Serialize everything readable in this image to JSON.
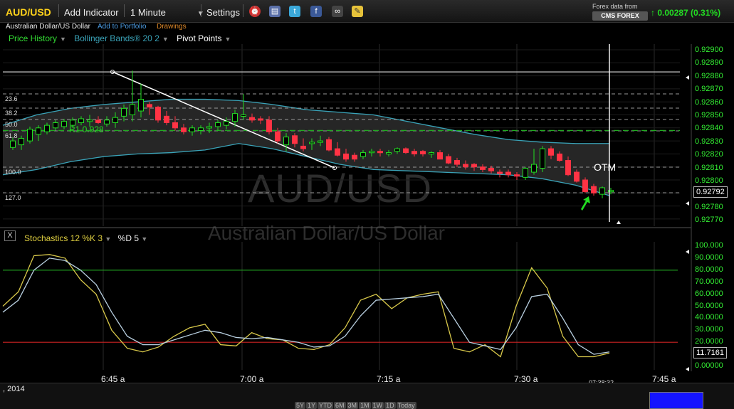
{
  "toolbar": {
    "symbol": "AUD/USD",
    "add_indicator": "Add Indicator",
    "interval": "1 Minute",
    "settings": "Settings",
    "provider_line1": "Forex data from",
    "provider_logo": "CMS FOREX",
    "change": "0.00287 (0.31%)",
    "change_arrow": "↑"
  },
  "subtitle": {
    "pair_name": "Australian Dollar/US Dollar",
    "add_portfolio": "Add to Portfolio",
    "drawings": "Drawings"
  },
  "legend": {
    "price_history": "Price History",
    "bollinger": "Bollinger Bands® 20 2",
    "pivot": "Pivot Points"
  },
  "stochastics": {
    "close": "X",
    "label": "Stochastics 12 %K 3",
    "d_label": "%D 5",
    "current": "11.7161",
    "y_ticks": [
      "100.000",
      "90.0000",
      "80.0000",
      "70.0000",
      "60.0000",
      "50.0000",
      "40.0000",
      "30.0000",
      "20.0000",
      "10.0000",
      "0.00000"
    ]
  },
  "watermark": {
    "symbol": "AUD/USD",
    "name": "Australian Dollar/US Dollar"
  },
  "price_axis": {
    "ticks": [
      "0.92900",
      "0.92890",
      "0.92880",
      "0.92870",
      "0.92860",
      "0.92850",
      "0.92840",
      "0.92830",
      "0.92820",
      "0.92810",
      "0.92800",
      "0.92790",
      "0.92780",
      "0.92770"
    ],
    "current": "0.92792"
  },
  "fib_levels": [
    "23.6",
    "38.2",
    "50.0",
    "61.8",
    "100.0",
    "127.0"
  ],
  "annotations": {
    "r1": "R1 0.928",
    "otm": "OTM"
  },
  "time_axis": {
    "ticks": [
      "6:45 a",
      "7:00 a",
      "7:15 a",
      "7:30 a",
      "7:45 a"
    ],
    "now": "07:38:32"
  },
  "date_label": ", 2014",
  "range_buttons": [
    "5Y",
    "1Y",
    "YTD",
    "6M",
    "3M",
    "1M",
    "1W",
    "1D",
    "Today"
  ],
  "colors": {
    "up": "#22dd22",
    "down": "#ff3344",
    "accent": "#ffd21a",
    "band": "#3aa3b8",
    "k_line": "#d8c84a",
    "d_line": "#b8cfe0"
  },
  "chart_data": [
    {
      "type": "candlestick",
      "title": "AUD/USD",
      "interval": "1 Minute",
      "ylim": [
        0.92767,
        0.92905
      ],
      "x_ticks": [
        "6:45 a",
        "7:00 a",
        "7:15 a",
        "7:30 a",
        "7:45 a"
      ],
      "candles": [
        [
          0.92825,
          0.92833,
          0.92823,
          0.9283
        ],
        [
          0.92827,
          0.92834,
          0.92823,
          0.92832
        ],
        [
          0.9283,
          0.92841,
          0.92828,
          0.92839
        ],
        [
          0.92835,
          0.92842,
          0.9283,
          0.9284
        ],
        [
          0.92837,
          0.92844,
          0.92835,
          0.92842
        ],
        [
          0.9284,
          0.92846,
          0.92838,
          0.92844
        ],
        [
          0.92841,
          0.92847,
          0.92839,
          0.92845
        ],
        [
          0.92842,
          0.92848,
          0.9284,
          0.92846
        ],
        [
          0.92844,
          0.92849,
          0.92842,
          0.92847
        ],
        [
          0.92845,
          0.9285,
          0.92841,
          0.92846
        ],
        [
          0.92846,
          0.92849,
          0.92843,
          0.92844
        ],
        [
          0.92843,
          0.92849,
          0.92841,
          0.92846
        ],
        [
          0.92844,
          0.92852,
          0.9284,
          0.92848
        ],
        [
          0.92849,
          0.92858,
          0.92845,
          0.92855
        ],
        [
          0.9285,
          0.92884,
          0.92845,
          0.92858
        ],
        [
          0.92853,
          0.92874,
          0.92848,
          0.92862
        ],
        [
          0.92858,
          0.9286,
          0.9285,
          0.92856
        ],
        [
          0.92856,
          0.92857,
          0.92844,
          0.92846
        ],
        [
          0.92849,
          0.92853,
          0.92842,
          0.92844
        ],
        [
          0.92844,
          0.92849,
          0.92838,
          0.9284
        ],
        [
          0.9284,
          0.92843,
          0.92835,
          0.92837
        ],
        [
          0.92837,
          0.92842,
          0.92834,
          0.9284
        ],
        [
          0.92838,
          0.92842,
          0.92835,
          0.9284
        ],
        [
          0.9284,
          0.92844,
          0.92836,
          0.92841
        ],
        [
          0.92841,
          0.92846,
          0.92838,
          0.92844
        ],
        [
          0.92842,
          0.92848,
          0.92839,
          0.92845
        ],
        [
          0.92845,
          0.92854,
          0.92841,
          0.92851
        ],
        [
          0.92849,
          0.92866,
          0.92846,
          0.9285
        ],
        [
          0.92848,
          0.92851,
          0.92844,
          0.92846
        ],
        [
          0.92847,
          0.92849,
          0.92843,
          0.92846
        ],
        [
          0.92846,
          0.92849,
          0.92835,
          0.92837
        ],
        [
          0.92837,
          0.9284,
          0.92828,
          0.9283
        ],
        [
          0.92827,
          0.92836,
          0.92822,
          0.92833
        ],
        [
          0.92834,
          0.92836,
          0.92825,
          0.92828
        ],
        [
          0.92826,
          0.92832,
          0.92822,
          0.92824
        ],
        [
          0.92828,
          0.92832,
          0.92823,
          0.92829
        ],
        [
          0.9283,
          0.92834,
          0.92826,
          0.9283
        ],
        [
          0.92831,
          0.92833,
          0.92822,
          0.92823
        ],
        [
          0.92824,
          0.92829,
          0.92818,
          0.92819
        ],
        [
          0.9282,
          0.92824,
          0.92814,
          0.92816
        ],
        [
          0.92819,
          0.92821,
          0.92814,
          0.92816
        ],
        [
          0.92818,
          0.92823,
          0.92816,
          0.92821
        ],
        [
          0.92821,
          0.92824,
          0.92818,
          0.92822
        ],
        [
          0.92822,
          0.92824,
          0.92818,
          0.92821
        ],
        [
          0.9282,
          0.92823,
          0.92818,
          0.92821
        ],
        [
          0.92822,
          0.92825,
          0.9282,
          0.92824
        ],
        [
          0.92824,
          0.92825,
          0.9282,
          0.92821
        ],
        [
          0.92822,
          0.92824,
          0.92818,
          0.9282
        ],
        [
          0.92822,
          0.92823,
          0.92818,
          0.9282
        ],
        [
          0.9282,
          0.92822,
          0.92817,
          0.92821
        ],
        [
          0.92821,
          0.92823,
          0.92816,
          0.92816
        ],
        [
          0.92818,
          0.9282,
          0.92812,
          0.92813
        ],
        [
          0.92815,
          0.92817,
          0.9281,
          0.92812
        ],
        [
          0.92812,
          0.92815,
          0.92808,
          0.9281
        ],
        [
          0.92812,
          0.92813,
          0.92807,
          0.9281
        ],
        [
          0.9281,
          0.92812,
          0.92806,
          0.92808
        ],
        [
          0.92809,
          0.92811,
          0.92805,
          0.92807
        ],
        [
          0.92806,
          0.92808,
          0.92802,
          0.92805
        ],
        [
          0.92806,
          0.92808,
          0.92802,
          0.92804
        ],
        [
          0.92804,
          0.92806,
          0.928,
          0.92803
        ],
        [
          0.92802,
          0.9281,
          0.928,
          0.92809
        ],
        [
          0.92806,
          0.92824,
          0.92804,
          0.92812
        ],
        [
          0.92809,
          0.92826,
          0.92806,
          0.92824
        ],
        [
          0.92824,
          0.92826,
          0.92816,
          0.92819
        ],
        [
          0.9282,
          0.92822,
          0.92814,
          0.92815
        ],
        [
          0.92815,
          0.92818,
          0.92803,
          0.92804
        ],
        [
          0.92806,
          0.92808,
          0.92798,
          0.92799
        ],
        [
          0.928,
          0.92802,
          0.9279,
          0.92791
        ],
        [
          0.92795,
          0.92797,
          0.92788,
          0.9279
        ],
        [
          0.92789,
          0.92795,
          0.92786,
          0.92794
        ],
        [
          0.92791,
          0.92794,
          0.92789,
          0.92792
        ]
      ],
      "bollinger_upper": [
        0.92842,
        0.9285,
        0.92855,
        0.92858,
        0.9286,
        0.92862,
        0.92862,
        0.92861,
        0.92858,
        0.92854,
        0.92852,
        0.9285,
        0.92845,
        0.9284,
        0.92835,
        0.92831,
        0.92829,
        0.92828,
        0.92828
      ],
      "bollinger_lower": [
        0.92804,
        0.92808,
        0.92814,
        0.92818,
        0.9282,
        0.92821,
        0.92823,
        0.92828,
        0.92824,
        0.92818,
        0.92812,
        0.92808,
        0.92807,
        0.92806,
        0.92805,
        0.92804,
        0.92801,
        0.92796,
        0.92788
      ],
      "reference_levels": {
        "horizontal_top": 0.92883,
        "r1": 0.92838,
        "pivot_mid": 0.92811
      }
    },
    {
      "type": "line",
      "title": "Stochastics 12 %K 3 %D 5",
      "ylim": [
        0,
        100
      ],
      "reference_lines": [
        80,
        20
      ],
      "series": [
        {
          "name": "%K",
          "values": [
            50,
            62,
            92,
            93,
            90,
            72,
            60,
            30,
            15,
            12,
            16,
            25,
            32,
            35,
            18,
            17,
            28,
            23,
            22,
            15,
            14,
            18,
            32,
            55,
            60,
            48,
            57,
            60,
            62,
            15,
            12,
            18,
            8,
            50,
            82,
            65,
            25,
            8,
            8,
            11
          ]
        },
        {
          "name": "%D",
          "values": [
            45,
            55,
            80,
            90,
            88,
            80,
            68,
            45,
            25,
            18,
            18,
            22,
            26,
            30,
            28,
            24,
            23,
            24,
            22,
            20,
            16,
            17,
            25,
            42,
            55,
            56,
            57,
            58,
            60,
            40,
            20,
            17,
            14,
            32,
            58,
            60,
            40,
            18,
            10,
            12
          ]
        }
      ]
    }
  ]
}
